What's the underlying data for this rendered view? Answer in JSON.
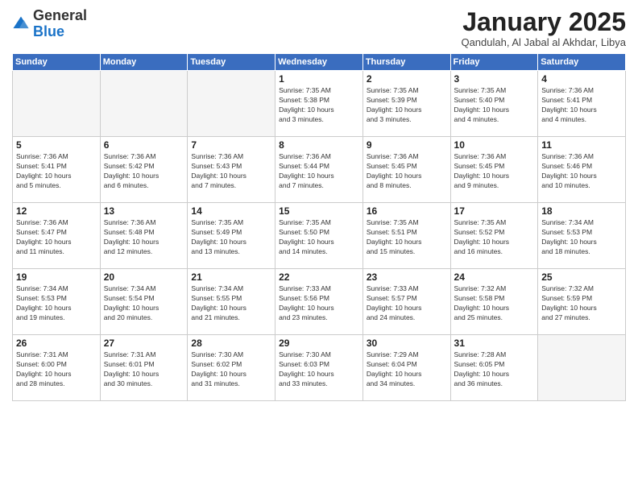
{
  "header": {
    "logo_general": "General",
    "logo_blue": "Blue",
    "month_title": "January 2025",
    "subtitle": "Qandulah, Al Jabal al Akhdar, Libya"
  },
  "days_of_week": [
    "Sunday",
    "Monday",
    "Tuesday",
    "Wednesday",
    "Thursday",
    "Friday",
    "Saturday"
  ],
  "weeks": [
    [
      {
        "day": "",
        "info": ""
      },
      {
        "day": "",
        "info": ""
      },
      {
        "day": "",
        "info": ""
      },
      {
        "day": "1",
        "info": "Sunrise: 7:35 AM\nSunset: 5:38 PM\nDaylight: 10 hours\nand 3 minutes."
      },
      {
        "day": "2",
        "info": "Sunrise: 7:35 AM\nSunset: 5:39 PM\nDaylight: 10 hours\nand 3 minutes."
      },
      {
        "day": "3",
        "info": "Sunrise: 7:35 AM\nSunset: 5:40 PM\nDaylight: 10 hours\nand 4 minutes."
      },
      {
        "day": "4",
        "info": "Sunrise: 7:36 AM\nSunset: 5:41 PM\nDaylight: 10 hours\nand 4 minutes."
      }
    ],
    [
      {
        "day": "5",
        "info": "Sunrise: 7:36 AM\nSunset: 5:41 PM\nDaylight: 10 hours\nand 5 minutes."
      },
      {
        "day": "6",
        "info": "Sunrise: 7:36 AM\nSunset: 5:42 PM\nDaylight: 10 hours\nand 6 minutes."
      },
      {
        "day": "7",
        "info": "Sunrise: 7:36 AM\nSunset: 5:43 PM\nDaylight: 10 hours\nand 7 minutes."
      },
      {
        "day": "8",
        "info": "Sunrise: 7:36 AM\nSunset: 5:44 PM\nDaylight: 10 hours\nand 7 minutes."
      },
      {
        "day": "9",
        "info": "Sunrise: 7:36 AM\nSunset: 5:45 PM\nDaylight: 10 hours\nand 8 minutes."
      },
      {
        "day": "10",
        "info": "Sunrise: 7:36 AM\nSunset: 5:45 PM\nDaylight: 10 hours\nand 9 minutes."
      },
      {
        "day": "11",
        "info": "Sunrise: 7:36 AM\nSunset: 5:46 PM\nDaylight: 10 hours\nand 10 minutes."
      }
    ],
    [
      {
        "day": "12",
        "info": "Sunrise: 7:36 AM\nSunset: 5:47 PM\nDaylight: 10 hours\nand 11 minutes."
      },
      {
        "day": "13",
        "info": "Sunrise: 7:36 AM\nSunset: 5:48 PM\nDaylight: 10 hours\nand 12 minutes."
      },
      {
        "day": "14",
        "info": "Sunrise: 7:35 AM\nSunset: 5:49 PM\nDaylight: 10 hours\nand 13 minutes."
      },
      {
        "day": "15",
        "info": "Sunrise: 7:35 AM\nSunset: 5:50 PM\nDaylight: 10 hours\nand 14 minutes."
      },
      {
        "day": "16",
        "info": "Sunrise: 7:35 AM\nSunset: 5:51 PM\nDaylight: 10 hours\nand 15 minutes."
      },
      {
        "day": "17",
        "info": "Sunrise: 7:35 AM\nSunset: 5:52 PM\nDaylight: 10 hours\nand 16 minutes."
      },
      {
        "day": "18",
        "info": "Sunrise: 7:34 AM\nSunset: 5:53 PM\nDaylight: 10 hours\nand 18 minutes."
      }
    ],
    [
      {
        "day": "19",
        "info": "Sunrise: 7:34 AM\nSunset: 5:53 PM\nDaylight: 10 hours\nand 19 minutes."
      },
      {
        "day": "20",
        "info": "Sunrise: 7:34 AM\nSunset: 5:54 PM\nDaylight: 10 hours\nand 20 minutes."
      },
      {
        "day": "21",
        "info": "Sunrise: 7:34 AM\nSunset: 5:55 PM\nDaylight: 10 hours\nand 21 minutes."
      },
      {
        "day": "22",
        "info": "Sunrise: 7:33 AM\nSunset: 5:56 PM\nDaylight: 10 hours\nand 23 minutes."
      },
      {
        "day": "23",
        "info": "Sunrise: 7:33 AM\nSunset: 5:57 PM\nDaylight: 10 hours\nand 24 minutes."
      },
      {
        "day": "24",
        "info": "Sunrise: 7:32 AM\nSunset: 5:58 PM\nDaylight: 10 hours\nand 25 minutes."
      },
      {
        "day": "25",
        "info": "Sunrise: 7:32 AM\nSunset: 5:59 PM\nDaylight: 10 hours\nand 27 minutes."
      }
    ],
    [
      {
        "day": "26",
        "info": "Sunrise: 7:31 AM\nSunset: 6:00 PM\nDaylight: 10 hours\nand 28 minutes."
      },
      {
        "day": "27",
        "info": "Sunrise: 7:31 AM\nSunset: 6:01 PM\nDaylight: 10 hours\nand 30 minutes."
      },
      {
        "day": "28",
        "info": "Sunrise: 7:30 AM\nSunset: 6:02 PM\nDaylight: 10 hours\nand 31 minutes."
      },
      {
        "day": "29",
        "info": "Sunrise: 7:30 AM\nSunset: 6:03 PM\nDaylight: 10 hours\nand 33 minutes."
      },
      {
        "day": "30",
        "info": "Sunrise: 7:29 AM\nSunset: 6:04 PM\nDaylight: 10 hours\nand 34 minutes."
      },
      {
        "day": "31",
        "info": "Sunrise: 7:28 AM\nSunset: 6:05 PM\nDaylight: 10 hours\nand 36 minutes."
      },
      {
        "day": "",
        "info": ""
      }
    ]
  ]
}
